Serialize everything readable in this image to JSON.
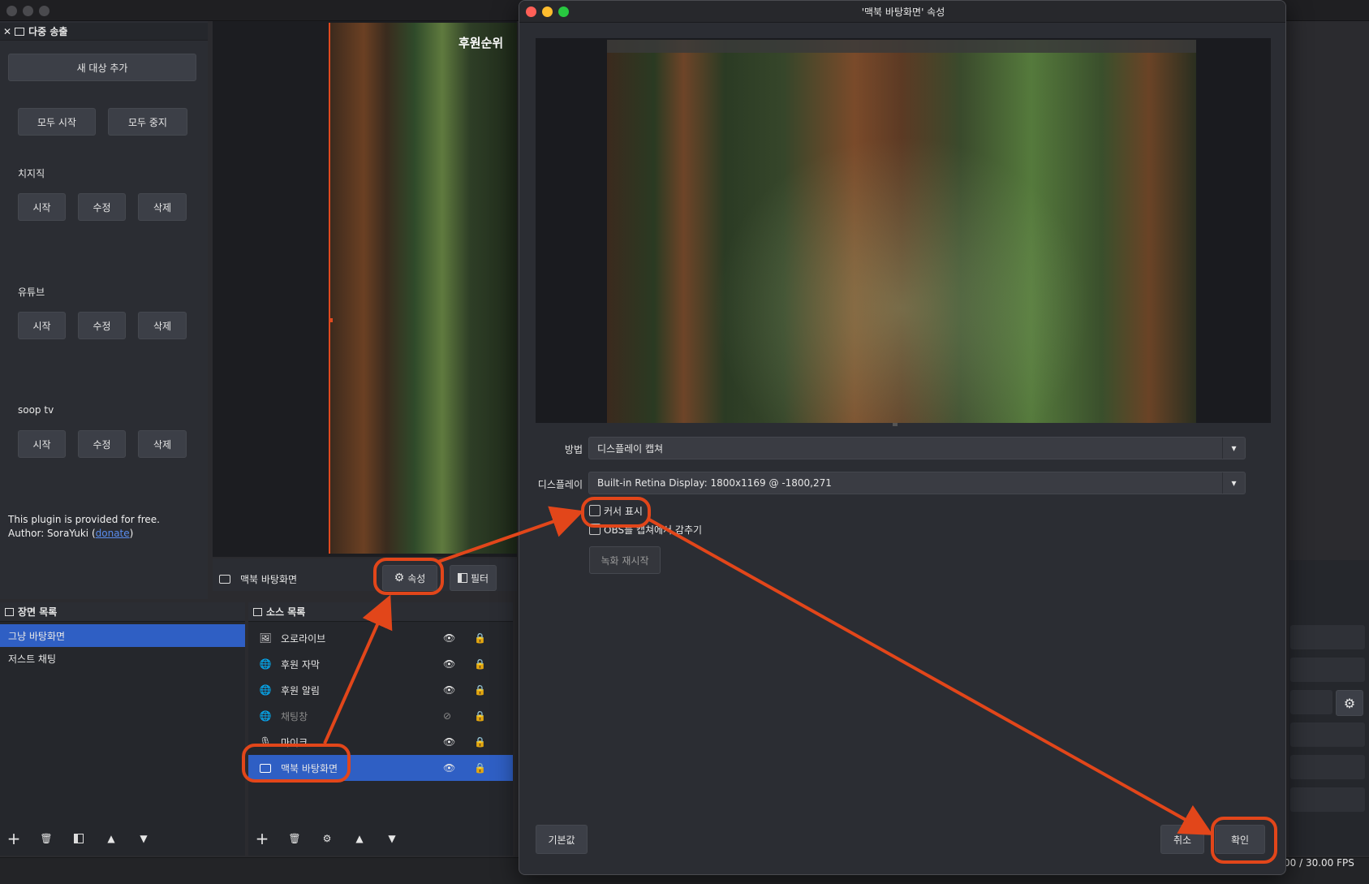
{
  "dock": {
    "title": "다중 송출",
    "add_target": "새 대상 추가",
    "start_all": "모두 시작",
    "stop_all": "모두 중지",
    "groups": [
      {
        "name": "치지직",
        "start": "시작",
        "edit": "수정",
        "delete": "삭제"
      },
      {
        "name": "유튜브",
        "start": "시작",
        "edit": "수정",
        "delete": "삭제"
      },
      {
        "name": "soop tv",
        "start": "시작",
        "edit": "수정",
        "delete": "삭제"
      }
    ],
    "note_line1": "This plugin is provided for free.",
    "note_author": "Author: SoraYuki (",
    "note_link": "donate",
    "note_close": ")"
  },
  "preview": {
    "overlay_text": "후원순위"
  },
  "source_toolbar": {
    "source_name": "맥북 바탕화면",
    "properties": "속성",
    "filters": "필터"
  },
  "scenes": {
    "title": "장면 목록",
    "items": [
      "그냥 바탕화면",
      "저스트 채팅"
    ]
  },
  "sources": {
    "title": "소스 목록",
    "items": [
      {
        "label": "오로라이브",
        "icon": "image-icon",
        "visible": true
      },
      {
        "label": "후원 자막",
        "icon": "globe-icon",
        "visible": true
      },
      {
        "label": "후원 알림",
        "icon": "globe-icon",
        "visible": true
      },
      {
        "label": "채팅창",
        "icon": "globe-icon",
        "visible": false
      },
      {
        "label": "마이크",
        "icon": "mic-icon",
        "visible": true
      },
      {
        "label": "맥북 바탕화면",
        "icon": "display-icon",
        "visible": true,
        "selected": true
      }
    ]
  },
  "status": {
    "fps": "00 / 30.00 FPS"
  },
  "dialog": {
    "title": "'맥북 바탕화면' 속성",
    "method_label": "방법",
    "method_value": "디스플레이 캡쳐",
    "display_label": "디스플레이",
    "display_value": "Built-in Retina Display: 1800x1169 @ -1800,271",
    "show_cursor": "커서 표시",
    "hide_obs": "OBS를 캡쳐에서 감추기",
    "restart_capture": "녹화 재시작",
    "defaults": "기본값",
    "cancel": "취소",
    "ok": "확인"
  },
  "colors": {
    "accent": "#2f5fc4",
    "annotation": "#e2461a",
    "traffic_red": "#ff5f57",
    "traffic_yellow": "#febc2e",
    "traffic_green": "#28c840"
  }
}
